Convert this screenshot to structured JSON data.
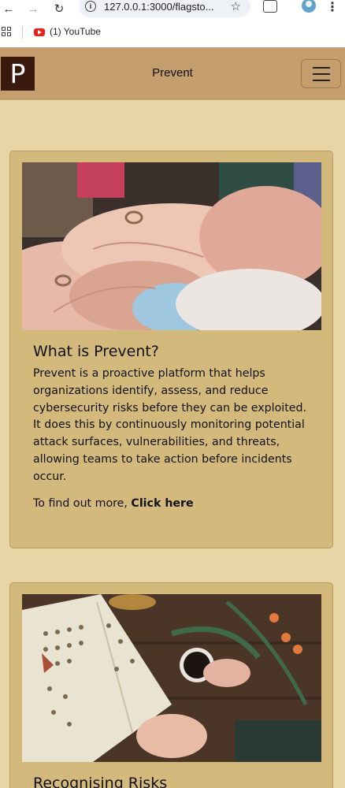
{
  "browser": {
    "url": "127.0.0.1:3000/flagsto...",
    "bookmark_label": "(1) YouTube",
    "back_icon": "back-arrow-icon",
    "forward_icon": "forward-arrow-icon",
    "reload_icon": "reload-icon"
  },
  "header": {
    "logo_letter": "P",
    "title": "Prevent",
    "menu_icon": "hamburger-icon",
    "bg_color": "#c49e6c"
  },
  "cards": [
    {
      "image": "stacked-hands-photo",
      "title": "What is Prevent?",
      "text": "Prevent is a proactive platform that helps organizations identify, assess, and reduce cybersecurity risks before they can be exploited. It does this by continuously monitoring potential attack surfaces, vulnerabilities, and threats, allowing teams to take action before incidents occur.",
      "more_prefix": "To find out more, ",
      "more_link": "Click here"
    },
    {
      "image": "book-and-coffee-photo",
      "title": "Recognising Risks"
    }
  ],
  "colors": {
    "page_bg": "#e8d5a6",
    "card_bg": "#d3b97c",
    "logo_bg": "#3a1a0c"
  }
}
